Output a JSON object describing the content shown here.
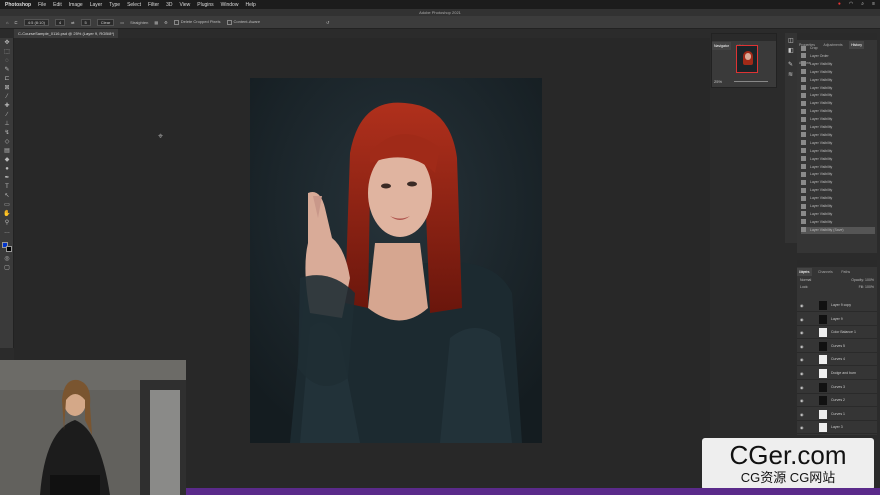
{
  "menubar": {
    "app_name": "Photoshop",
    "items": [
      "File",
      "Edit",
      "Image",
      "Layer",
      "Type",
      "Select",
      "Filter",
      "3D",
      "View",
      "Plugins",
      "Window",
      "Help"
    ]
  },
  "window": {
    "title": "Adobe Photoshop 2021"
  },
  "options_bar": {
    "ratio_label": "4:5 (8:10)",
    "width_value": "4",
    "height_value": "5",
    "clear_label": "Clear",
    "straighten_label": "Straighten",
    "delete_cropped_label": "Delete Cropped Pixels",
    "content_aware_label": "Content-Aware"
  },
  "document": {
    "tab_label": "C-CourseSample_0116.psd @ 25% (Layer 9, RGB/8*)"
  },
  "navigator": {
    "tabs": [
      "Navigator",
      "Histogram"
    ],
    "zoom": "25%"
  },
  "history": {
    "tabs": [
      "Properties",
      "Adjustments",
      "History",
      "Actions"
    ],
    "items": [
      "Crop",
      "Layer Order",
      "Layer Visibility",
      "Layer Visibility",
      "Layer Visibility",
      "Layer Visibility",
      "Layer Visibility",
      "Layer Visibility",
      "Layer Visibility",
      "Layer Visibility",
      "Layer Visibility",
      "Layer Visibility",
      "Layer Visibility",
      "Layer Visibility",
      "Layer Visibility",
      "Layer Visibility",
      "Layer Visibility",
      "Layer Visibility",
      "Layer Visibility",
      "Layer Visibility",
      "Layer Visibility",
      "Layer Visibility",
      "Layer Visibility",
      "Layer Visibility (Save)"
    ]
  },
  "layers": {
    "tabs": [
      "Layers",
      "Channels",
      "Paths"
    ],
    "kind_label": "Kind",
    "blend_mode": "Normal",
    "opacity_label": "Opacity:",
    "opacity_value": "100%",
    "lock_label": "Lock:",
    "fill_label": "Fill:",
    "fill_value": "100%",
    "rows": [
      "Layer 9 copy",
      "Layer 9",
      "Color Balance 1",
      "Curves 5",
      "Curves 4",
      "Dodge and burn",
      "Curves 3",
      "Curves 2",
      "Curves 1",
      "Layer 3"
    ]
  },
  "watermark": {
    "big": "CGer.com",
    "small": "CG资源 CG网站"
  }
}
